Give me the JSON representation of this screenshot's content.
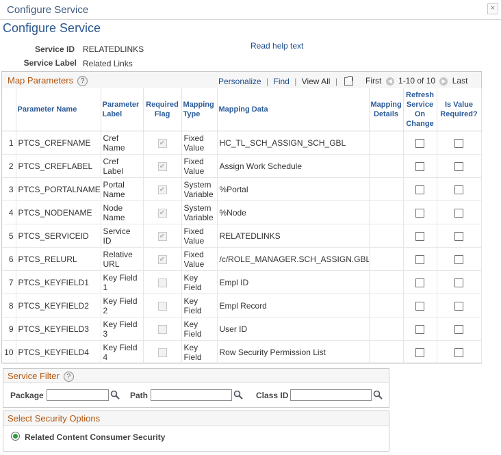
{
  "window": {
    "title": "Configure Service",
    "close_glyph": "×"
  },
  "page": {
    "title": "Configure Service"
  },
  "service": {
    "id_label": "Service ID",
    "id_value": "RELATEDLINKS",
    "name_label": "Service Label",
    "name_value": "Related Links",
    "help_link": "Read help text"
  },
  "grid": {
    "title": "Map Parameters",
    "help_glyph": "?",
    "nav": {
      "personalize": "Personalize",
      "find": "Find",
      "view_all": "View All"
    },
    "pager": {
      "first": "First",
      "range": "1-10 of 10",
      "last": "Last",
      "prev_glyph": "◀",
      "next_glyph": "▶"
    },
    "columns": [
      "Parameter Name",
      "Parameter Label",
      "Required Flag",
      "Mapping Type",
      "Mapping Data",
      "Mapping Details",
      "Refresh Service On Change",
      "Is Value Required?"
    ],
    "rows": [
      {
        "n": "1",
        "name": "PTCS_CREFNAME",
        "label": "Cref Name",
        "required": true,
        "type": "Fixed Value",
        "data": "HC_TL_SCH_ASSIGN_SCH_GBL",
        "details": "",
        "refresh": false,
        "valreq": false
      },
      {
        "n": "2",
        "name": "PTCS_CREFLABEL",
        "label": "Cref Label",
        "required": true,
        "type": "Fixed Value",
        "data": "Assign Work Schedule",
        "details": "",
        "refresh": false,
        "valreq": false
      },
      {
        "n": "3",
        "name": "PTCS_PORTALNAME",
        "label": "Portal Name",
        "required": true,
        "type": "System Variable",
        "data": "%Portal",
        "details": "",
        "refresh": false,
        "valreq": false
      },
      {
        "n": "4",
        "name": "PTCS_NODENAME",
        "label": "Node Name",
        "required": true,
        "type": "System Variable",
        "data": "%Node",
        "details": "",
        "refresh": false,
        "valreq": false
      },
      {
        "n": "5",
        "name": "PTCS_SERVICEID",
        "label": "Service ID",
        "required": true,
        "type": "Fixed Value",
        "data": "RELATEDLINKS",
        "details": "",
        "refresh": false,
        "valreq": false
      },
      {
        "n": "6",
        "name": "PTCS_RELURL",
        "label": "Relative URL",
        "required": true,
        "type": "Fixed Value",
        "data": "/c/ROLE_MANAGER.SCH_ASSIGN.GBL",
        "details": "",
        "refresh": false,
        "valreq": false
      },
      {
        "n": "7",
        "name": "PTCS_KEYFIELD1",
        "label": "Key Field 1",
        "required": false,
        "type": "Key Field",
        "data": "Empl ID",
        "details": "",
        "refresh": false,
        "valreq": false
      },
      {
        "n": "8",
        "name": "PTCS_KEYFIELD2",
        "label": "Key Field 2",
        "required": false,
        "type": "Key Field",
        "data": "Empl Record",
        "details": "",
        "refresh": false,
        "valreq": false
      },
      {
        "n": "9",
        "name": "PTCS_KEYFIELD3",
        "label": "Key Field 3",
        "required": false,
        "type": "Key Field",
        "data": "User ID",
        "details": "",
        "refresh": false,
        "valreq": false
      },
      {
        "n": "10",
        "name": "PTCS_KEYFIELD4",
        "label": "Key Field 4",
        "required": false,
        "type": "Key Field",
        "data": "Row Security Permission List",
        "details": "",
        "refresh": false,
        "valreq": false
      }
    ]
  },
  "filter": {
    "title": "Service Filter",
    "help_glyph": "?",
    "package_label": "Package",
    "package_value": "",
    "path_label": "Path",
    "path_value": "",
    "classid_label": "Class ID",
    "classid_value": ""
  },
  "security": {
    "title": "Select Security Options",
    "option_label": "Related Content Consumer Security",
    "selected": true
  },
  "icons": {
    "lookup": "magnifier-icon",
    "help": "help-icon",
    "zoom": "popup-icon"
  },
  "colors": {
    "link": "#1c4d8c",
    "section_title": "#b2550e",
    "header_text": "#2b5b99",
    "radio_selected": "#2f9a3c"
  }
}
